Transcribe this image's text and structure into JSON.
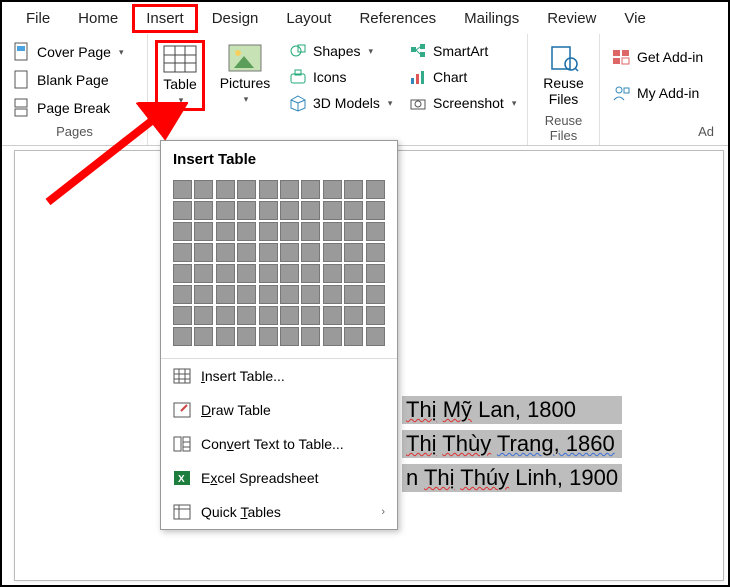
{
  "tabs": {
    "file": "File",
    "home": "Home",
    "insert": "Insert",
    "design": "Design",
    "layout": "Layout",
    "references": "References",
    "mailings": "Mailings",
    "review": "Review",
    "view": "Vie"
  },
  "pages": {
    "cover": "Cover Page",
    "blank": "Blank Page",
    "break": "Page Break",
    "group": "Pages"
  },
  "table": {
    "label": "Table"
  },
  "pictures": {
    "label": "Pictures"
  },
  "illus": {
    "shapes": "Shapes",
    "icons": "Icons",
    "models": "3D Models"
  },
  "illus2": {
    "smartart": "SmartArt",
    "chart": "Chart",
    "screenshot": "Screenshot"
  },
  "reuse": {
    "label": "Reuse\nFiles",
    "group": "Reuse Files"
  },
  "addins": {
    "get": "Get Add-in",
    "my": "My Add-in",
    "group": "Ad"
  },
  "dropdown": {
    "title": "Insert Table",
    "insert": "Insert Table...",
    "draw": "Draw Table",
    "convert": "Convert Text to Table...",
    "excel": "Excel Spreadsheet",
    "quick": "Quick Tables"
  },
  "truncated": "n",
  "doc": {
    "l1a": "Thị",
    "l1b": "Mỹ",
    "l1c": "Lan, 1800",
    "l2a": "Thị",
    "l2b": "Thùy",
    "l2c": "Trang, 1860",
    "l3a": "n",
    "l3b": "Thị",
    "l3c": "Thúy",
    "l3d": "Linh, 1900"
  }
}
